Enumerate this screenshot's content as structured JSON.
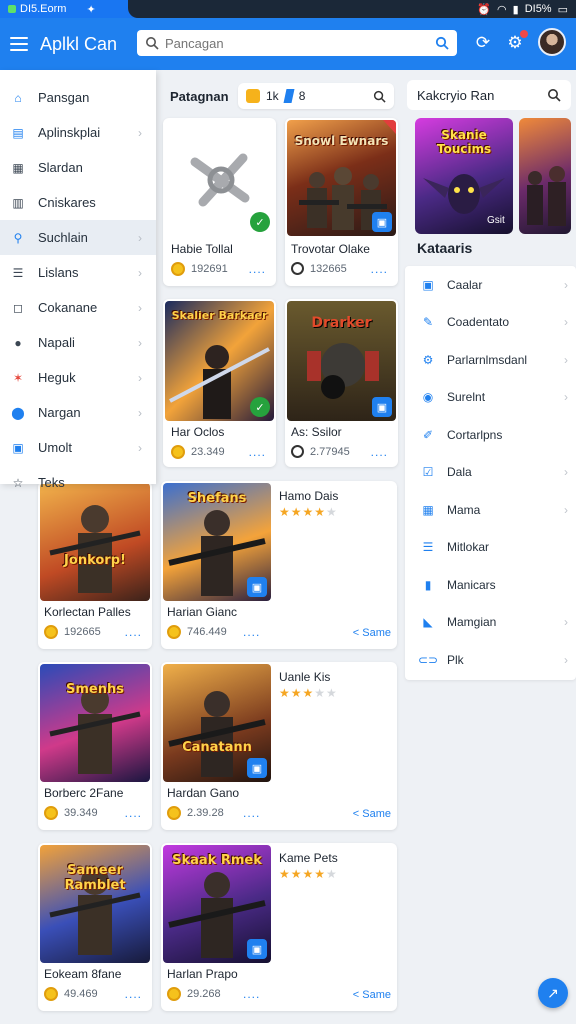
{
  "status": {
    "left_text": "DI5.Eorm",
    "right_text": "DI5%"
  },
  "app": {
    "title": "Aplkl Can",
    "search_placeholder": "Pancagan"
  },
  "drawer": {
    "items": [
      {
        "label": "Pansgan",
        "icon": "home-icon",
        "active": false,
        "chevron": false
      },
      {
        "label": "Aplinskplai",
        "icon": "lock-icon",
        "active": false,
        "chevron": true
      },
      {
        "label": "Slardan",
        "icon": "grid-icon",
        "active": false,
        "chevron": false
      },
      {
        "label": "Cniskares",
        "icon": "tag-icon",
        "active": false,
        "chevron": false
      },
      {
        "label": "Suchlain",
        "icon": "search-icon",
        "active": true,
        "chevron": true
      },
      {
        "label": "Lislans",
        "icon": "list-icon",
        "active": false,
        "chevron": true
      },
      {
        "label": "Cokanane",
        "icon": "square-icon",
        "active": false,
        "chevron": true
      },
      {
        "label": "Napali",
        "icon": "chat-icon",
        "active": false,
        "chevron": true
      },
      {
        "label": "Heguk",
        "icon": "star-burst-icon",
        "active": false,
        "chevron": true
      },
      {
        "label": "Nargan",
        "icon": "location-icon",
        "active": false,
        "chevron": true
      },
      {
        "label": "Umolt",
        "icon": "app-icon",
        "active": false,
        "chevron": true
      },
      {
        "label": "Teks",
        "icon": "star-icon",
        "active": false,
        "chevron": false
      }
    ]
  },
  "center": {
    "title": "Patagnan",
    "stat1": "1k",
    "stat2": "8",
    "more": "....",
    "share_label": "Same",
    "small_cards": [
      {
        "title": "Habie Tollal",
        "count": "192691",
        "meta": "coin",
        "thumb": "joystick",
        "badge": "green"
      },
      {
        "title": "Trovotar Olake",
        "count": "132665",
        "meta": "ring",
        "thumb": "Snowl Ewnars",
        "badge": "blue"
      },
      {
        "title": "Har Oclos",
        "count": "23.349",
        "meta": "coin",
        "thumb": "Skalier Barkaer",
        "badge": "green"
      },
      {
        "title": "As: Ssilor",
        "count": "2.77945",
        "meta": "ring",
        "thumb": "Drarker",
        "badge": "blue"
      }
    ],
    "wide_cards": [
      {
        "title1": "Korlectan Palles",
        "count1": "192665",
        "thumb1": "Jonkorp!",
        "title2": "Harian Gianc",
        "count2": "746.449",
        "thumb2": "Shefans",
        "side_title": "Hamo Dais",
        "rating": 4
      },
      {
        "title1": "Borberc 2Fane",
        "count1": "39.349",
        "thumb1": "Smenhs",
        "title2": "Hardan Gano",
        "count2": "2.39.28",
        "thumb2": "Canatann",
        "side_title": "Uanle Kis",
        "rating": 3
      },
      {
        "title1": "Eokeam 8fane",
        "count1": "49.469",
        "thumb1": "Sameer Ramblet",
        "title2": "Harlan Prapo",
        "count2": "29.268",
        "thumb2": "Skaak Rmek",
        "side_title": "Kame Pets",
        "rating": 4
      }
    ]
  },
  "right": {
    "title": "Kakcryio Ran",
    "feature1": "Skanie Toucims",
    "feature1_tag": "Gsit",
    "section_title": "Kataaris",
    "categories": [
      {
        "label": "Caalar",
        "icon": "doc-icon",
        "chevron": true
      },
      {
        "label": "Coadentato",
        "icon": "edit-icon",
        "chevron": true
      },
      {
        "label": "Parlarnlmsdanl",
        "icon": "settings-icon",
        "chevron": true
      },
      {
        "label": "Surelnt",
        "icon": "info-icon",
        "chevron": true
      },
      {
        "label": "Cortarlpns",
        "icon": "pen-icon",
        "chevron": false
      },
      {
        "label": "Dala",
        "icon": "check-icon",
        "chevron": true
      },
      {
        "label": "Mama",
        "icon": "grid-icon",
        "chevron": true
      },
      {
        "label": "Mitlokar",
        "icon": "list-icon",
        "chevron": false
      },
      {
        "label": "Manicars",
        "icon": "bottle-icon",
        "chevron": false
      },
      {
        "label": "Mamgian",
        "icon": "flag-icon",
        "chevron": true
      },
      {
        "label": "Plk",
        "icon": "link-icon",
        "chevron": true
      }
    ]
  },
  "colors": {
    "primary": "#1f80ef",
    "accent_star": "#f5a623",
    "background": "#eef1f5"
  }
}
